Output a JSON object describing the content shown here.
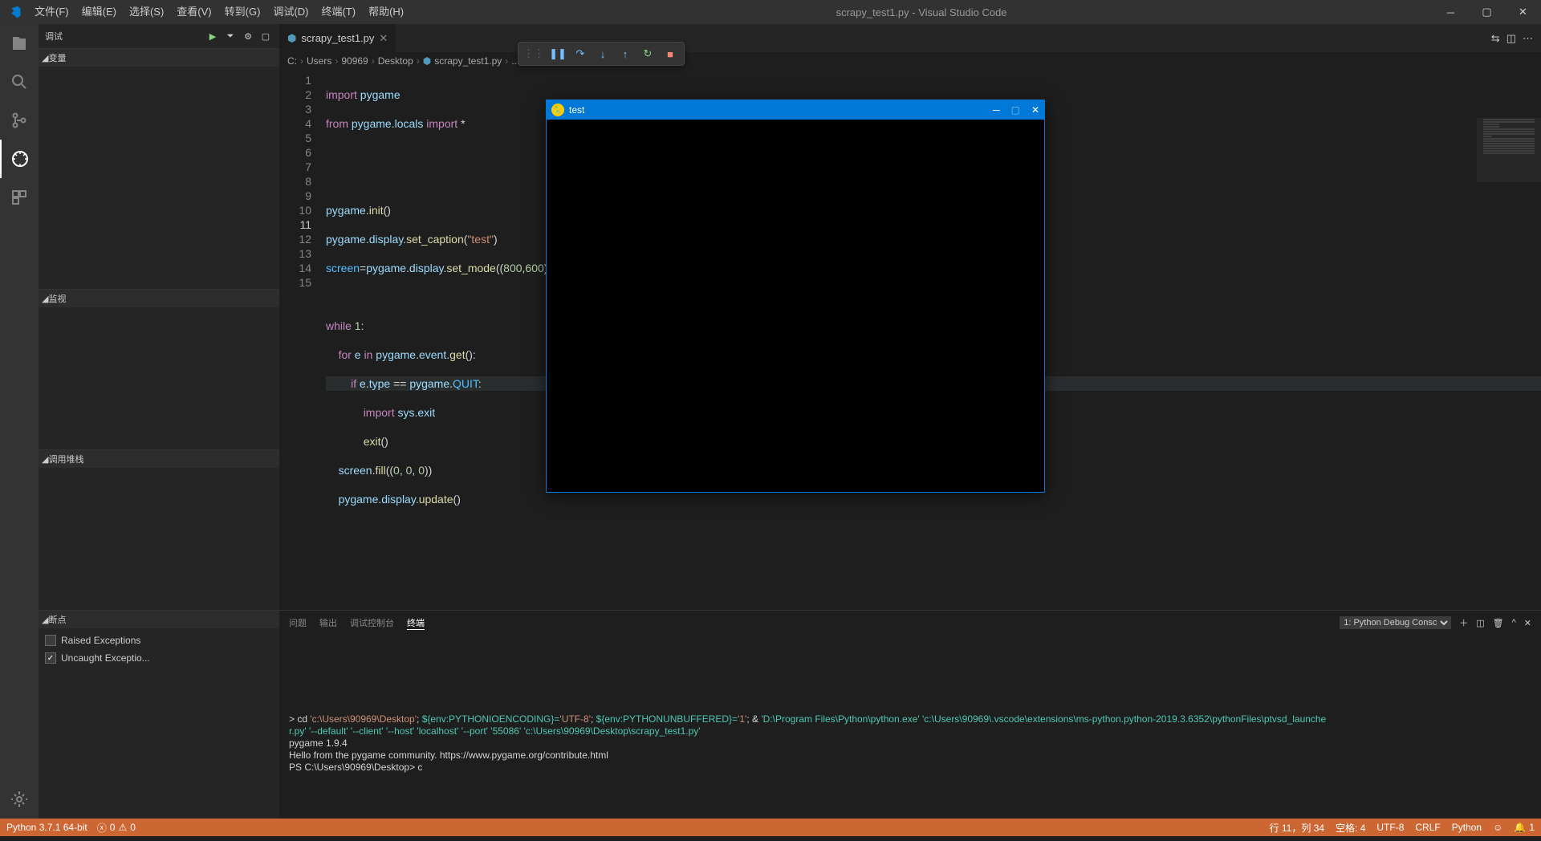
{
  "titlebar": {
    "menus": [
      "文件(F)",
      "编辑(E)",
      "选择(S)",
      "查看(V)",
      "转到(G)",
      "调试(D)",
      "终端(T)",
      "帮助(H)"
    ],
    "title": "scrapy_test1.py - Visual Studio Code"
  },
  "sidebar": {
    "debug_label": "调试",
    "sections": {
      "variables": "变量",
      "watch": "监视",
      "callstack": "调用堆栈",
      "breakpoints": "断点"
    },
    "breakpoints": {
      "raised": "Raised Exceptions",
      "uncaught": "Uncaught Exceptio..."
    }
  },
  "tab": {
    "filename": "scrapy_test1.py"
  },
  "breadcrumbs": [
    "C:",
    "Users",
    "90969",
    "Desktop",
    "scrapy_test1.py",
    "..."
  ],
  "code": {
    "lines": [
      1,
      2,
      3,
      4,
      5,
      6,
      7,
      8,
      9,
      10,
      11,
      12,
      13,
      14,
      15
    ]
  },
  "panel": {
    "tabs": [
      "问题",
      "输出",
      "调试控制台",
      "终端"
    ],
    "dropdown": "1: Python Debug Consc",
    "terminal": {
      "cd_prefix": "> cd ",
      "cd_path": "'c:\\Users\\90969\\Desktop'",
      "semi": "; ",
      "env1_k": "${env:PYTHONIOENCODING}=",
      "env1_v": "'UTF-8'",
      "env2_k": "${env:PYTHONUNBUFFERED}=",
      "env2_v": "'1'",
      "amp": "; & ",
      "exe": "'D:\\Program Files\\Python\\python.exe' 'c:\\Users\\90969\\.vscode\\extensions\\ms-python.python-2019.3.6352\\pythonFiles\\ptvsd_launche",
      "line2": "r.py' '--default' '--client' '--host' 'localhost' '--port' '55086' 'c:\\Users\\90969\\Desktop\\scrapy_test1.py'",
      "line3": "pygame 1.9.4",
      "line4": "Hello from the pygame community. https://www.pygame.org/contribute.html",
      "prompt": "PS C:\\Users\\90969\\Desktop> ",
      "typed": "c"
    }
  },
  "statusbar": {
    "python": "Python 3.7.1 64-bit",
    "errors": "0",
    "warnings": "0",
    "line_col": "行 11，列 34",
    "spaces": "空格: 4",
    "encoding": "UTF-8",
    "eol": "CRLF",
    "lang": "Python",
    "notif": "1"
  },
  "pygame": {
    "title": "test"
  }
}
